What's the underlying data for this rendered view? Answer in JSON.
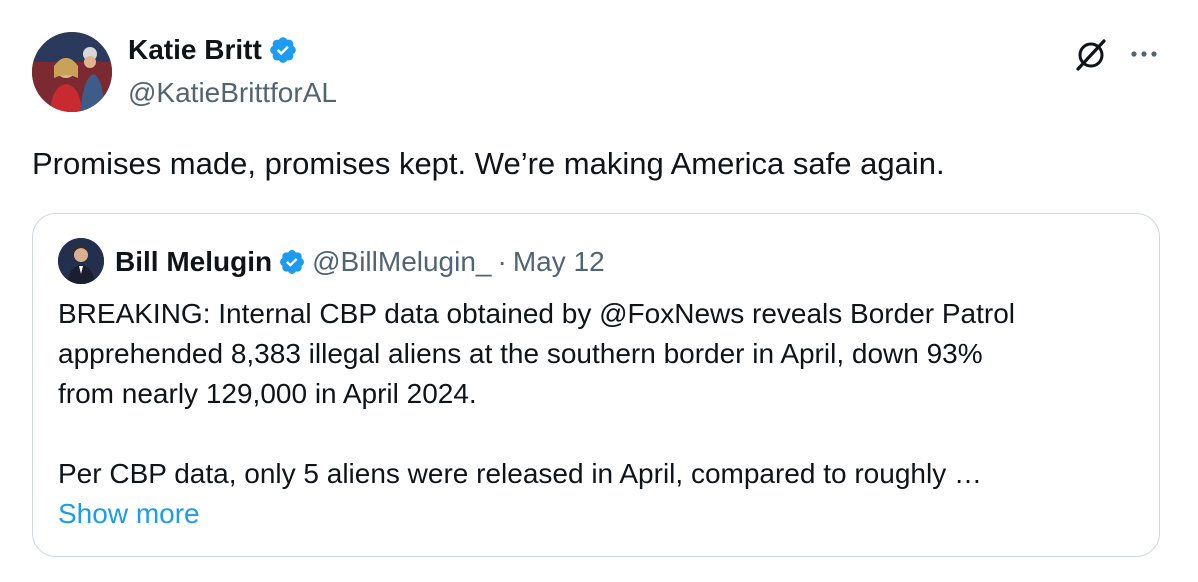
{
  "author": {
    "name": "Katie Britt",
    "handle": "@KatieBrittforAL",
    "verified_icon": "verified-badge-icon"
  },
  "tweet": {
    "text": "Promises made, promises kept. We’re making America safe again."
  },
  "quoted": {
    "name": "Bill Melugin",
    "handle": "@BillMelugin_",
    "separator": "·",
    "date": "May 12",
    "lines": [
      "BREAKING: Internal CBP data obtained by @FoxNews reveals Border Patrol",
      "apprehended 8,383 illegal aliens at the southern border in April, down 93%",
      "from nearly 129,000 in April 2024.",
      "Per CBP data, only 5 aliens were released in April, compared to roughly …"
    ],
    "show_more": "Show more"
  },
  "icons": {
    "grok": "grok-icon",
    "more": "more-options-icon"
  },
  "colors": {
    "text": "#0f1419",
    "secondary": "#536471",
    "link": "#1d9bf0",
    "verified": "#1d9bf0",
    "border": "#cfd9de"
  }
}
